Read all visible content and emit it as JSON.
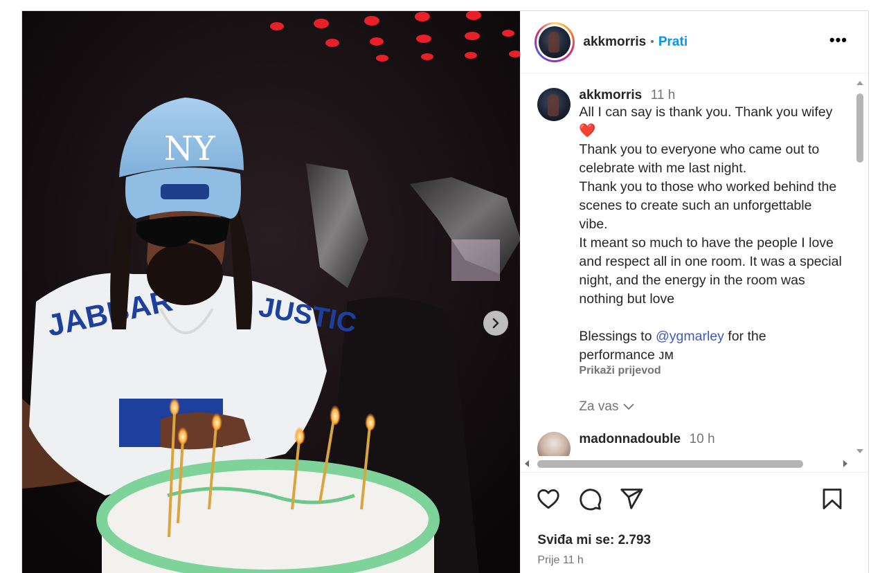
{
  "post": {
    "username": "akkmorris",
    "follow_label": "Prati",
    "more_label": "•••"
  },
  "caption": {
    "username": "akkmorris",
    "time": "11 h",
    "lines": [
      "All I can say is thank you. Thank you wifey ❤️",
      "Thank you to everyone who came out to celebrate with me last night.",
      "Thank you to those who worked behind the scenes to create such an unforgettable vibe.",
      "It meant so much to have the people I love and respect all in one room. It was a special night, and the energy in the room was nothing but love"
    ],
    "blessing_prefix": "Blessings to ",
    "mention": "@ygmarley",
    "blessing_suffix": " for the performance ᴊᴍ",
    "translate_label": "Prikaži prijevod",
    "for_you_label": "Za vas"
  },
  "next_comment": {
    "username": "madonnadouble",
    "time": "10 h"
  },
  "actions": {
    "likes_label": "Sviđa mi se: 2.793",
    "posted_label": "Prije 11 h"
  },
  "icons": [
    "heart-icon",
    "comment-icon",
    "share-icon",
    "save-icon",
    "chevron-right-icon",
    "chevron-down-icon"
  ],
  "colors": {
    "follow_blue": "#0095f6",
    "mention_blue": "#4059ba",
    "muted_text": "#737373",
    "heart_red": "#ed4956"
  }
}
